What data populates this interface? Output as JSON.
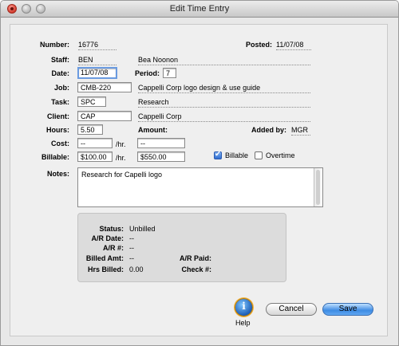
{
  "window": {
    "title": "Edit Time Entry"
  },
  "form": {
    "number_label": "Number:",
    "number": "16776",
    "posted_label": "Posted:",
    "posted": "11/07/08",
    "staff_label": "Staff:",
    "staff": "BEN",
    "staff_name": "Bea Noonon",
    "date_label": "Date:",
    "date": "11/07/08",
    "period_label": "Period:",
    "period": "7",
    "job_label": "Job:",
    "job": "CMB-220",
    "job_desc": "Cappelli Corp logo design & use guide",
    "task_label": "Task:",
    "task": "SPC",
    "task_desc": "Research",
    "client_label": "Client:",
    "client": "CAP",
    "client_name": "Cappelli Corp",
    "hours_label": "Hours:",
    "hours": "5.50",
    "amount_label": "Amount:",
    "added_by_label": "Added by:",
    "added_by": "MGR",
    "cost_label": "Cost:",
    "cost": "--",
    "cost_unit": "/hr.",
    "cost_amount": "--",
    "billable_label": "Billable:",
    "billable_rate": "$100.00",
    "billable_unit": "/hr.",
    "billable_amount": "$550.00",
    "billable_check_label": "Billable",
    "billable_checked": true,
    "overtime_check_label": "Overtime",
    "overtime_checked": false,
    "notes_label": "Notes:",
    "notes": "Research for Capelli logo"
  },
  "status": {
    "status_label": "Status:",
    "status": "Unbilled",
    "ar_date_label": "A/R Date:",
    "ar_date": "--",
    "ar_num_label": "A/R #:",
    "ar_num": "--",
    "billed_amt_label": "Billed Amt:",
    "billed_amt": "--",
    "ar_paid_label": "A/R Paid:",
    "hrs_billed_label": "Hrs Billed:",
    "hrs_billed": "0.00",
    "check_label": "Check #:"
  },
  "buttons": {
    "help": "Help",
    "cancel": "Cancel",
    "save": "Save"
  },
  "colors": {
    "accent": "#3d8be3",
    "focus_ring": "#6b9be0",
    "close": "#d13a2c"
  }
}
